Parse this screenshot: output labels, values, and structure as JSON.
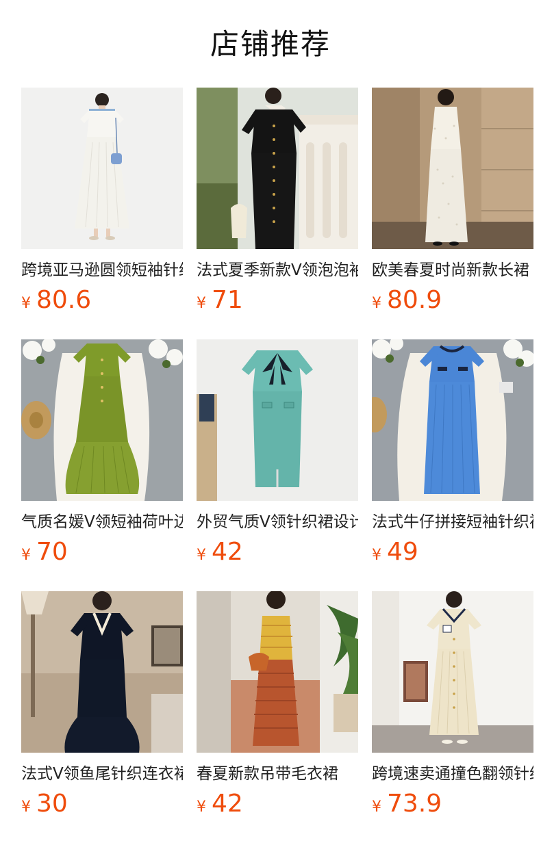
{
  "section": {
    "title": "店铺推荐"
  },
  "currency_symbol": "¥",
  "colors": {
    "price": "#ef4c0c",
    "title": "#111111",
    "text": "#222222"
  },
  "products": [
    {
      "title": "跨境亚马逊圆领短袖针织连衣裙",
      "price": "80.6"
    },
    {
      "title": "法式夏季新款V领泡泡袖针织裙",
      "price": "71"
    },
    {
      "title": "欧美春夏时尚新款长裙",
      "price": "80.9"
    },
    {
      "title": "气质名媛V领短袖荷叶边连衣裙",
      "price": "70"
    },
    {
      "title": "外贸气质V领针织裙设计感",
      "price": "42"
    },
    {
      "title": "法式牛仔拼接短袖针织裙",
      "price": "49"
    },
    {
      "title": "法式V领鱼尾针织连衣裙",
      "price": "30"
    },
    {
      "title": "春夏新款吊带毛衣裙",
      "price": "42"
    },
    {
      "title": "跨境速卖通撞色翻领针织裙",
      "price": "73.9"
    }
  ]
}
